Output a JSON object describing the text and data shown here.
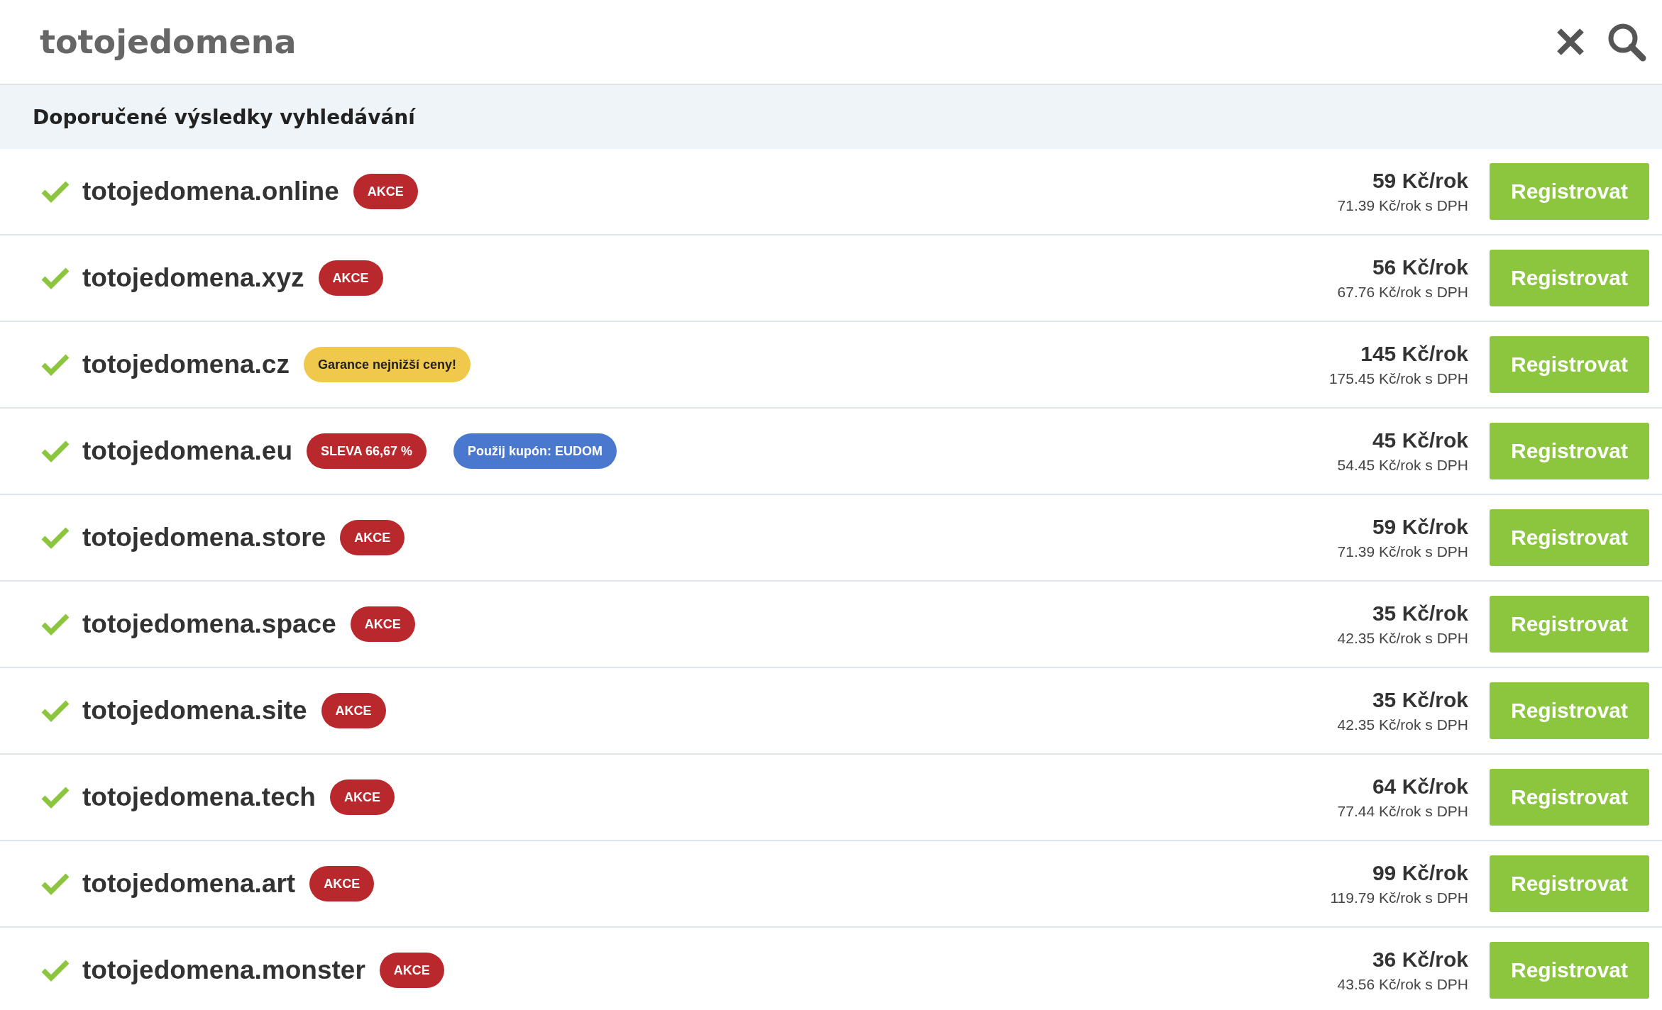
{
  "search": {
    "value": "totojedomena"
  },
  "section_title": "Doporučené výsledky vyhledávání",
  "results": [
    {
      "domain": "totojedomena.online",
      "available": true,
      "badges": [
        {
          "kind": "sale",
          "text": "AKCE"
        }
      ],
      "price": "59 Kč/rok",
      "price_vat": "71.39 Kč/rok s DPH",
      "button": "Registrovat"
    },
    {
      "domain": "totojedomena.xyz",
      "available": true,
      "badges": [
        {
          "kind": "sale",
          "text": "AKCE"
        }
      ],
      "price": "56 Kč/rok",
      "price_vat": "67.76 Kč/rok s DPH",
      "button": "Registrovat"
    },
    {
      "domain": "totojedomena.cz",
      "available": true,
      "badges": [
        {
          "kind": "guarantee",
          "text": "Garance nejnižší ceny!"
        }
      ],
      "price": "145 Kč/rok",
      "price_vat": "175.45 Kč/rok s DPH",
      "button": "Registrovat"
    },
    {
      "domain": "totojedomena.eu",
      "available": true,
      "badges": [
        {
          "kind": "sale",
          "text": "SLEVA 66,67 %"
        },
        {
          "kind": "coupon",
          "text": "Použij kupón: EUDOM"
        }
      ],
      "price": "45 Kč/rok",
      "price_vat": "54.45 Kč/rok s DPH",
      "button": "Registrovat"
    },
    {
      "domain": "totojedomena.store",
      "available": true,
      "badges": [
        {
          "kind": "sale",
          "text": "AKCE"
        }
      ],
      "price": "59 Kč/rok",
      "price_vat": "71.39 Kč/rok s DPH",
      "button": "Registrovat"
    },
    {
      "domain": "totojedomena.space",
      "available": true,
      "badges": [
        {
          "kind": "sale",
          "text": "AKCE"
        }
      ],
      "price": "35 Kč/rok",
      "price_vat": "42.35 Kč/rok s DPH",
      "button": "Registrovat"
    },
    {
      "domain": "totojedomena.site",
      "available": true,
      "badges": [
        {
          "kind": "sale",
          "text": "AKCE"
        }
      ],
      "price": "35 Kč/rok",
      "price_vat": "42.35 Kč/rok s DPH",
      "button": "Registrovat"
    },
    {
      "domain": "totojedomena.tech",
      "available": true,
      "badges": [
        {
          "kind": "sale",
          "text": "AKCE"
        }
      ],
      "price": "64 Kč/rok",
      "price_vat": "77.44 Kč/rok s DPH",
      "button": "Registrovat"
    },
    {
      "domain": "totojedomena.art",
      "available": true,
      "badges": [
        {
          "kind": "sale",
          "text": "AKCE"
        }
      ],
      "price": "99 Kč/rok",
      "price_vat": "119.79 Kč/rok s DPH",
      "button": "Registrovat"
    },
    {
      "domain": "totojedomena.monster",
      "available": true,
      "badges": [
        {
          "kind": "sale",
          "text": "AKCE"
        }
      ],
      "price": "36 Kč/rok",
      "price_vat": "43.56 Kč/rok s DPH",
      "button": "Registrovat"
    }
  ]
}
